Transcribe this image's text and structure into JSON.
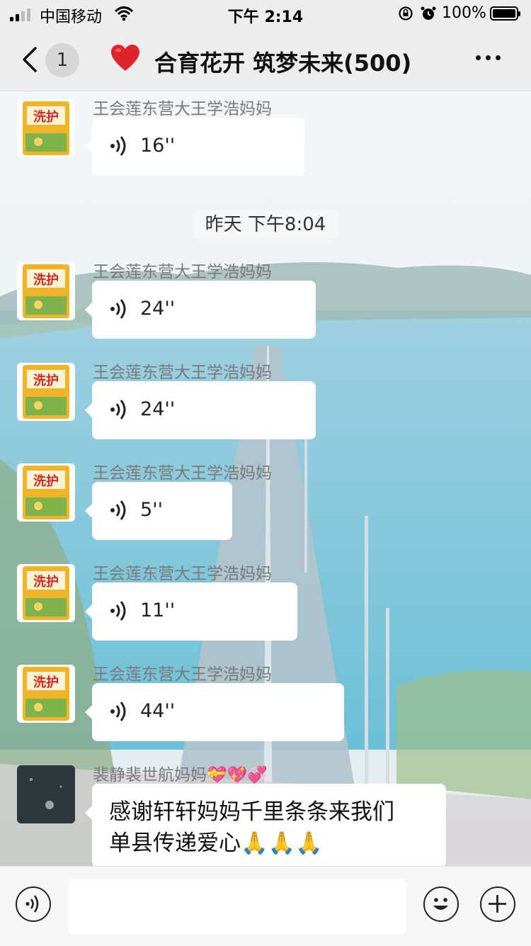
{
  "status_bar": {
    "carrier": "中国移动",
    "time": "下午 2:14",
    "battery": "100%"
  },
  "nav": {
    "unread_count": "1",
    "title": "合育花开 筑梦未来(500)",
    "heart_icon": "red-heart-emoji"
  },
  "messages": [
    {
      "sender": "王会莲东营大王学浩妈妈",
      "duration": "16''"
    },
    {
      "sender": "王会莲东营大王学浩妈妈",
      "duration": "24''"
    },
    {
      "sender": "王会莲东营大王学浩妈妈",
      "duration": "24''"
    },
    {
      "sender": "王会莲东营大王学浩妈妈",
      "duration": "5''"
    },
    {
      "sender": "王会莲东营大王学浩妈妈",
      "duration": "11''"
    },
    {
      "sender": "王会莲东营大王学浩妈妈",
      "duration": "44''"
    }
  ],
  "timestamp": "昨天 下午8:04",
  "text_message": {
    "sender": "裴静裴世航妈妈💝💖💞",
    "line1": "感谢轩轩妈妈千里条条来我们",
    "line2": "单县传递爱心🙏🙏🙏"
  },
  "input_bar": {
    "value": ""
  },
  "colors": {
    "bar_bg": "#ededed",
    "bubble": "#ffffff",
    "sender_text": "#7a7a7a"
  }
}
